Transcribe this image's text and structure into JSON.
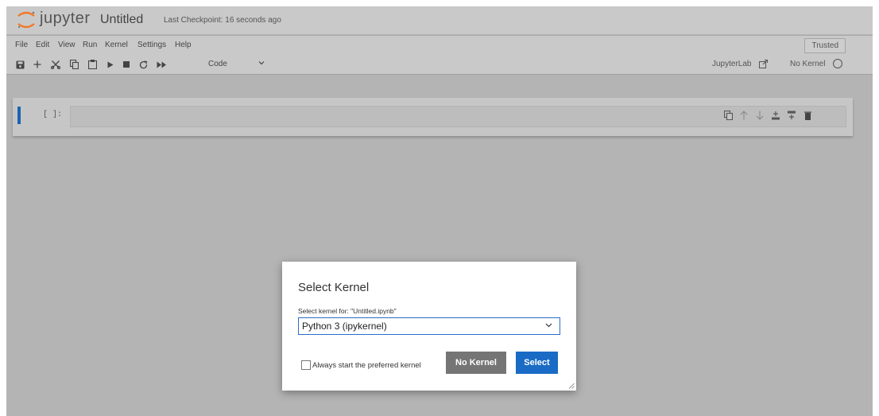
{
  "header": {
    "logo_text": "jupyter",
    "notebook_title": "Untitled",
    "checkpoint": "Last Checkpoint: 16 seconds ago"
  },
  "menu": {
    "items": [
      "File",
      "Edit",
      "View",
      "Run",
      "Kernel",
      "Settings",
      "Help"
    ],
    "trusted": "Trusted"
  },
  "toolbar": {
    "icons": [
      "save-icon",
      "add-icon",
      "cut-icon",
      "copy-icon",
      "paste-icon",
      "run-icon",
      "stop-icon",
      "restart-icon",
      "fast-forward-icon"
    ],
    "cell_type": "Code",
    "jupyterlab": "JupyterLab",
    "kernel_status": "No Kernel"
  },
  "cell": {
    "prompt": "[ ]:",
    "tools": [
      "duplicate-icon",
      "move-up-icon",
      "move-down-icon",
      "insert-above-icon",
      "insert-below-icon",
      "delete-icon"
    ]
  },
  "dialog": {
    "title": "Select Kernel",
    "label": "Select kernel for: \"Untitled.ipynb\"",
    "selected_kernel": "Python 3 (ipykernel)",
    "checkbox_label": "Always start the preferred kernel",
    "no_kernel_button": "No Kernel",
    "select_button": "Select"
  },
  "colors": {
    "accent": "#1a6bc5",
    "logo_orange": "#f37726",
    "overlay": "#b4b4b4",
    "secondary_button": "#757575"
  }
}
